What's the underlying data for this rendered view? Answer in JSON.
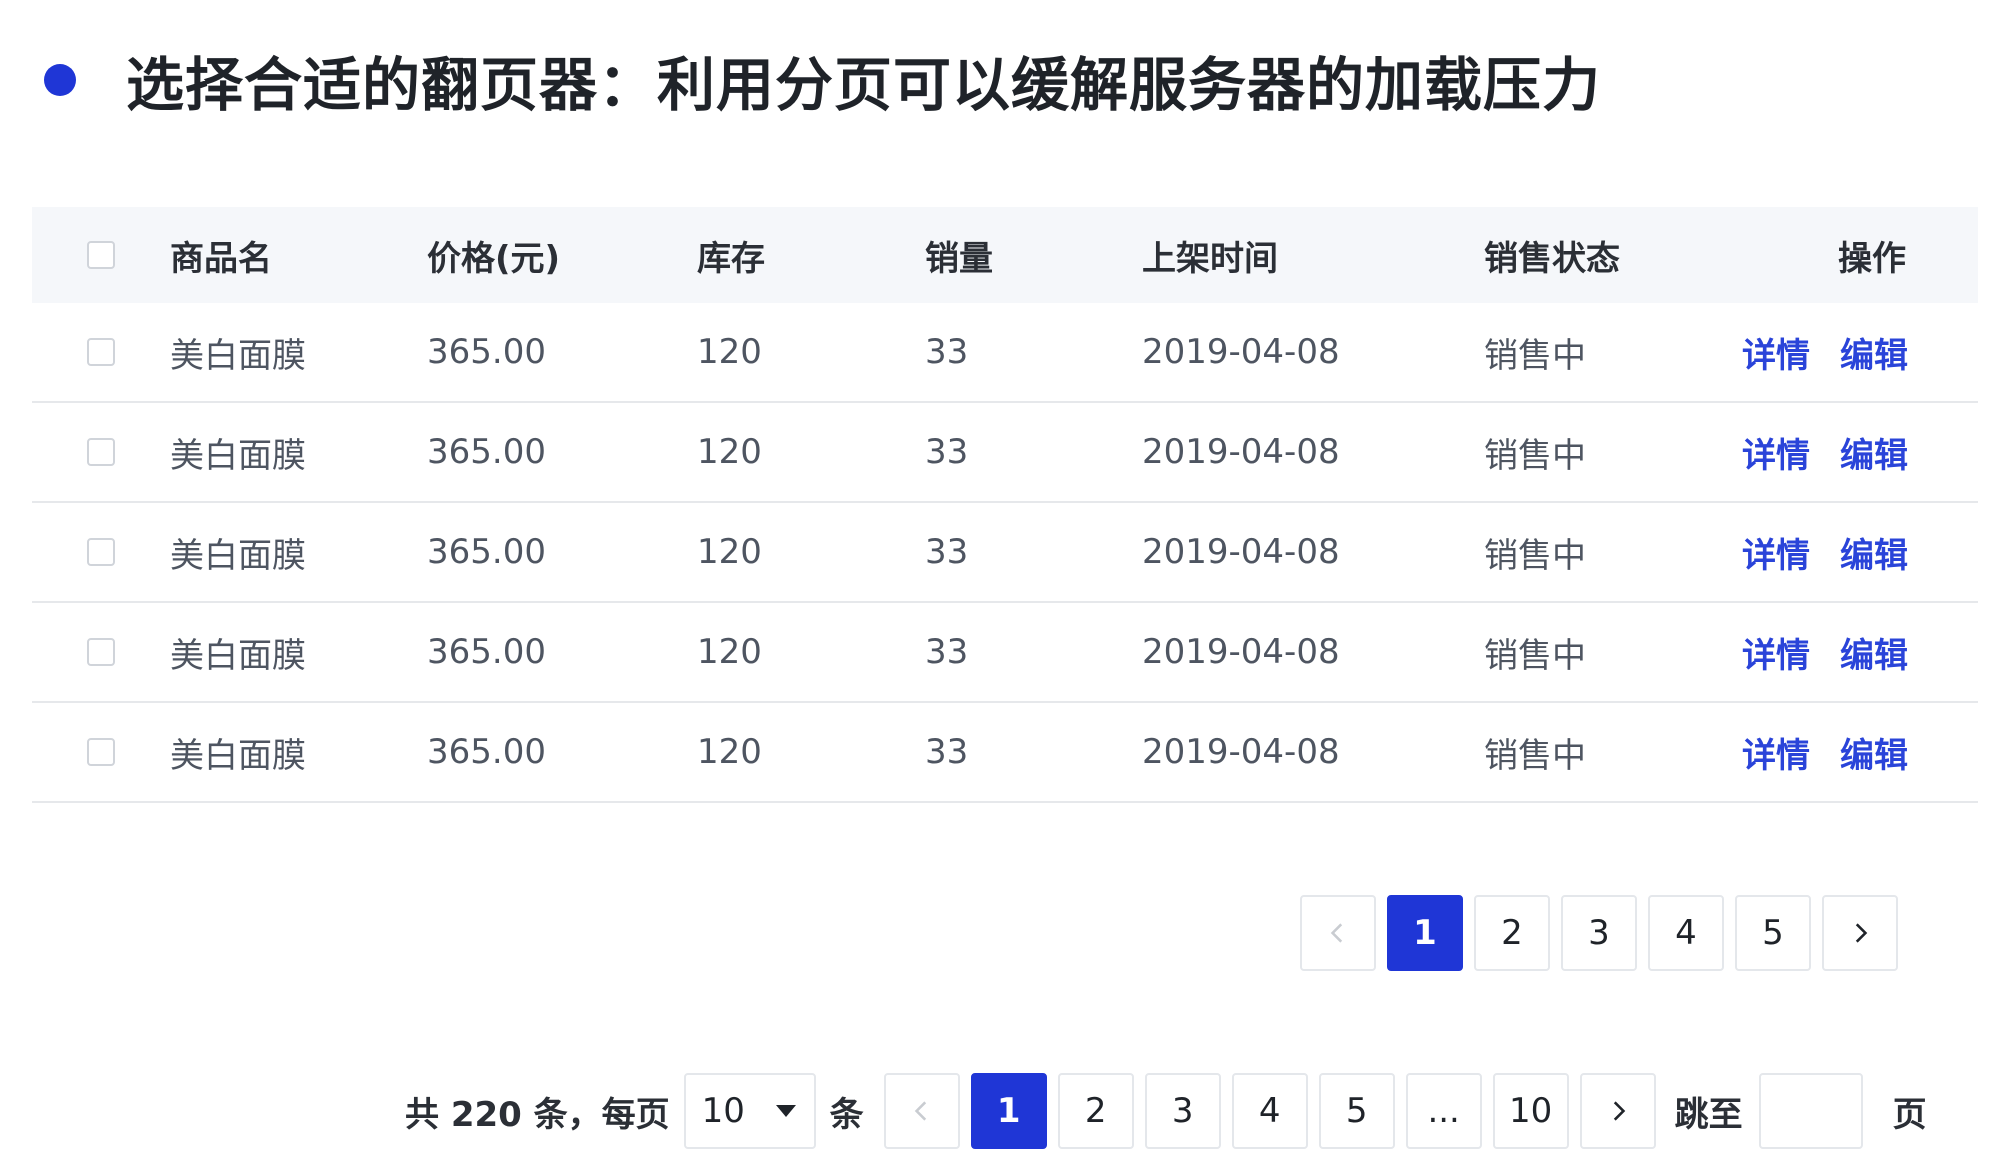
{
  "heading": {
    "text": "选择合适的翻页器：利用分页可以缓解服务器的加载压力"
  },
  "accent_color": "#1f36d6",
  "table": {
    "headers": [
      "商品名",
      "价格(元)",
      "库存",
      "销量",
      "上架时间",
      "销售状态",
      "操作"
    ],
    "rows": [
      {
        "name": "美白面膜",
        "price": "365.00",
        "stock": "120",
        "sales": "33",
        "date": "2019-04-08",
        "status": "销售中",
        "detail": "详情",
        "edit": "编辑"
      },
      {
        "name": "美白面膜",
        "price": "365.00",
        "stock": "120",
        "sales": "33",
        "date": "2019-04-08",
        "status": "销售中",
        "detail": "详情",
        "edit": "编辑"
      },
      {
        "name": "美白面膜",
        "price": "365.00",
        "stock": "120",
        "sales": "33",
        "date": "2019-04-08",
        "status": "销售中",
        "detail": "详情",
        "edit": "编辑"
      },
      {
        "name": "美白面膜",
        "price": "365.00",
        "stock": "120",
        "sales": "33",
        "date": "2019-04-08",
        "status": "销售中",
        "detail": "详情",
        "edit": "编辑"
      },
      {
        "name": "美白面膜",
        "price": "365.00",
        "stock": "120",
        "sales": "33",
        "date": "2019-04-08",
        "status": "销售中",
        "detail": "详情",
        "edit": "编辑"
      }
    ]
  },
  "pager_simple": {
    "pages": [
      "1",
      "2",
      "3",
      "4",
      "5"
    ],
    "current": "1"
  },
  "pager_full": {
    "total_text": "共 220 条，每页",
    "page_size": "10",
    "unit_text": "条",
    "pages": [
      "1",
      "2",
      "3",
      "4",
      "5",
      "...",
      "10"
    ],
    "current": "1",
    "jump_label": "跳至",
    "jump_value": "",
    "page_suffix": "页"
  }
}
